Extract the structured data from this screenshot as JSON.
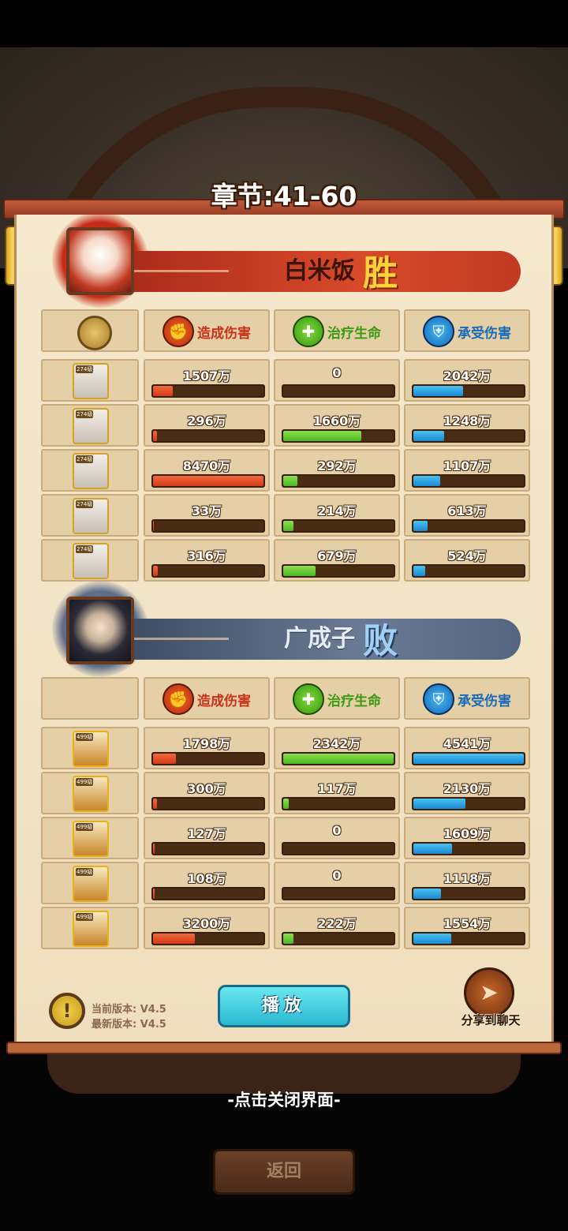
{
  "chapter": {
    "title": "章节:41-60"
  },
  "headers": {
    "damage": "造成伤害",
    "heal": "治疗生命",
    "taken": "承受伤害"
  },
  "team_win": {
    "name": "白米饭",
    "result": "胜",
    "rows": [
      {
        "level": "274级",
        "damage": "1507万",
        "damage_frac": 0.18,
        "heal": "0",
        "heal_frac": 0.0,
        "taken": "2042万",
        "taken_frac": 0.45
      },
      {
        "level": "274级",
        "damage": "296万",
        "damage_frac": 0.035,
        "heal": "1660万",
        "heal_frac": 0.71,
        "taken": "1248万",
        "taken_frac": 0.28
      },
      {
        "level": "274级",
        "damage": "8470万",
        "damage_frac": 1.0,
        "heal": "292万",
        "heal_frac": 0.13,
        "taken": "1107万",
        "taken_frac": 0.24
      },
      {
        "level": "274级",
        "damage": "33万",
        "damage_frac": 0.01,
        "heal": "214万",
        "heal_frac": 0.09,
        "taken": "613万",
        "taken_frac": 0.13
      },
      {
        "level": "274级",
        "damage": "316万",
        "damage_frac": 0.04,
        "heal": "679万",
        "heal_frac": 0.29,
        "taken": "524万",
        "taken_frac": 0.11
      }
    ]
  },
  "team_lose": {
    "name": "广成子",
    "result": "败",
    "rows": [
      {
        "level": "499级",
        "damage": "1798万",
        "damage_frac": 0.21,
        "heal": "2342万",
        "heal_frac": 1.0,
        "taken": "4541万",
        "taken_frac": 1.0
      },
      {
        "level": "499级",
        "damage": "300万",
        "damage_frac": 0.035,
        "heal": "117万",
        "heal_frac": 0.05,
        "taken": "2130万",
        "taken_frac": 0.47
      },
      {
        "level": "499级",
        "damage": "127万",
        "damage_frac": 0.015,
        "heal": "0",
        "heal_frac": 0.0,
        "taken": "1609万",
        "taken_frac": 0.35
      },
      {
        "level": "499级",
        "damage": "108万",
        "damage_frac": 0.013,
        "heal": "0",
        "heal_frac": 0.0,
        "taken": "1118万",
        "taken_frac": 0.25
      },
      {
        "level": "499级",
        "damage": "3200万",
        "damage_frac": 0.38,
        "heal": "222万",
        "heal_frac": 0.095,
        "taken": "1554万",
        "taken_frac": 0.34
      }
    ]
  },
  "footer": {
    "info_icon": "!",
    "current_version": "当前版本: V4.5",
    "latest_version": "最新版本: V4.5",
    "play_label": "播放",
    "share_label": "分享到聊天",
    "share_icon": "paper-plane-icon"
  },
  "close_hint": "-点击关闭界面-",
  "back_label": "返回",
  "colors": {
    "damage": "#d43a1a",
    "heal": "#4ab826",
    "taken": "#1a8ad4"
  }
}
